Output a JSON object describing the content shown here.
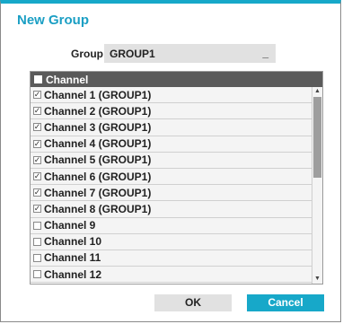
{
  "dialog": {
    "title": "New Group",
    "group_label": "Group",
    "group_value": "GROUP1",
    "cursor": "_"
  },
  "list": {
    "header": "Channel",
    "rows": [
      {
        "label": "Channel 1 (GROUP1)",
        "checked": true
      },
      {
        "label": "Channel 2 (GROUP1)",
        "checked": true
      },
      {
        "label": "Channel 3 (GROUP1)",
        "checked": true
      },
      {
        "label": "Channel 4 (GROUP1)",
        "checked": true
      },
      {
        "label": "Channel 5 (GROUP1)",
        "checked": true
      },
      {
        "label": "Channel 6 (GROUP1)",
        "checked": true
      },
      {
        "label": "Channel 7 (GROUP1)",
        "checked": true
      },
      {
        "label": "Channel 8 (GROUP1)",
        "checked": true
      },
      {
        "label": "Channel 9",
        "checked": false
      },
      {
        "label": "Channel 10",
        "checked": false
      },
      {
        "label": "Channel 11",
        "checked": false
      },
      {
        "label": "Channel 12",
        "checked": false
      }
    ]
  },
  "buttons": {
    "ok": "OK",
    "cancel": "Cancel"
  },
  "colors": {
    "accent": "#17a8c9",
    "header": "#5a5a5a"
  },
  "icons": {
    "checkmark": "✓",
    "scroll_up": "▲",
    "scroll_down": "▼"
  }
}
